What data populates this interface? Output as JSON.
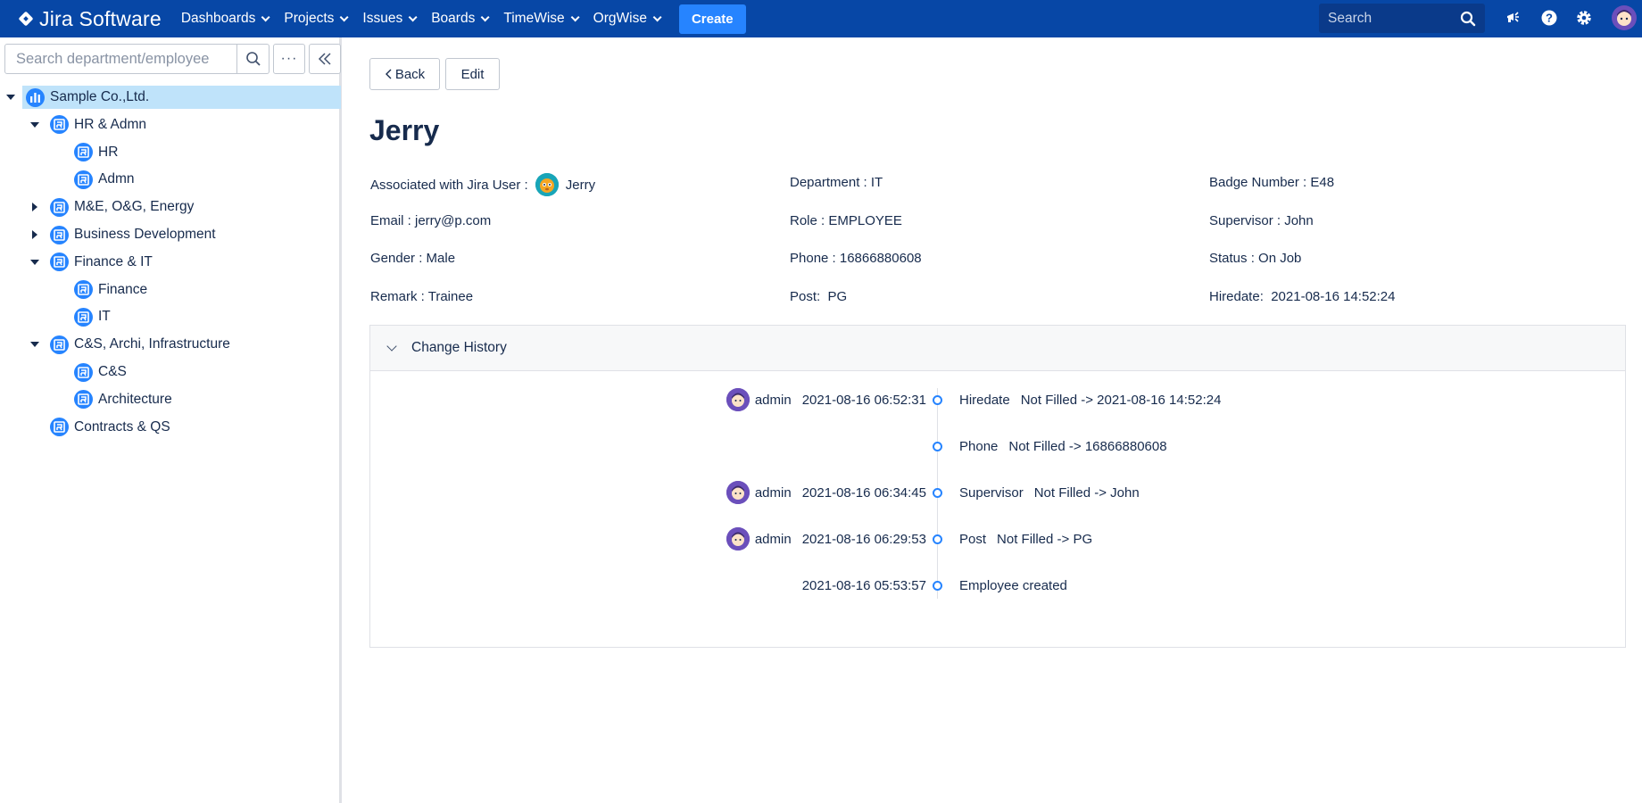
{
  "topbar": {
    "logo_text": "Jira Software",
    "nav": [
      "Dashboards",
      "Projects",
      "Issues",
      "Boards",
      "TimeWise",
      "OrgWise"
    ],
    "create_label": "Create",
    "search_placeholder": "Search",
    "icons": [
      "search-icon",
      "notifications-icon",
      "help-icon",
      "settings-icon",
      "profile-avatar"
    ],
    "brand_color": "#0747a6",
    "create_color": "#2684ff"
  },
  "sidebar": {
    "search_placeholder": "Search department/employee",
    "tree": [
      {
        "label": "Sample Co.,Ltd.",
        "level": 0,
        "expanded": true,
        "selected": true,
        "type": "company"
      },
      {
        "label": "HR & Admn",
        "level": 1,
        "expanded": true,
        "type": "dept"
      },
      {
        "label": "HR",
        "level": 2,
        "type": "dept"
      },
      {
        "label": "Admn",
        "level": 2,
        "type": "dept"
      },
      {
        "label": "M&E, O&G, Energy",
        "level": 1,
        "expanded": false,
        "type": "dept"
      },
      {
        "label": "Business Development",
        "level": 1,
        "expanded": false,
        "type": "dept"
      },
      {
        "label": "Finance & IT",
        "level": 1,
        "expanded": true,
        "type": "dept"
      },
      {
        "label": "Finance",
        "level": 2,
        "type": "dept"
      },
      {
        "label": "IT",
        "level": 2,
        "type": "dept"
      },
      {
        "label": "C&S, Archi, Infrastructure",
        "level": 1,
        "expanded": true,
        "type": "dept"
      },
      {
        "label": "C&S",
        "level": 2,
        "type": "dept"
      },
      {
        "label": "Architecture",
        "level": 2,
        "type": "dept"
      },
      {
        "label": "Contracts & QS",
        "level": 1,
        "type": "dept"
      }
    ]
  },
  "main": {
    "back_label": "Back",
    "edit_label": "Edit",
    "employee_name": "Jerry",
    "fields": {
      "jira_user_label": "Associated with Jira User :",
      "jira_user_name": "Jerry",
      "department": "Department : IT",
      "badge": "Badge Number : E48",
      "email": "Email : jerry@p.com",
      "role": "Role : EMPLOYEE",
      "supervisor": "Supervisor : John",
      "gender": "Gender : Male",
      "phone": "Phone : 16866880608",
      "status": "Status : On Job",
      "remark": "Remark : Trainee",
      "post": "Post:  PG",
      "hiredate": "Hiredate:  2021-08-16 14:52:24"
    },
    "history": {
      "title": "Change History",
      "entries": [
        {
          "user": "admin",
          "time": "2021-08-16 06:52:31",
          "field": "Hiredate",
          "change": "Not Filled -> 2021-08-16 14:52:24"
        },
        {
          "user": "",
          "time": "",
          "field": "Phone",
          "change": "Not Filled -> 16866880608"
        },
        {
          "user": "admin",
          "time": "2021-08-16 06:34:45",
          "field": "Supervisor",
          "change": "Not Filled -> John"
        },
        {
          "user": "admin",
          "time": "2021-08-16 06:29:53",
          "field": "Post",
          "change": "Not Filled -> PG"
        },
        {
          "user": "",
          "time": "2021-08-16 05:53:57",
          "field": "Employee created",
          "change": ""
        }
      ]
    }
  }
}
